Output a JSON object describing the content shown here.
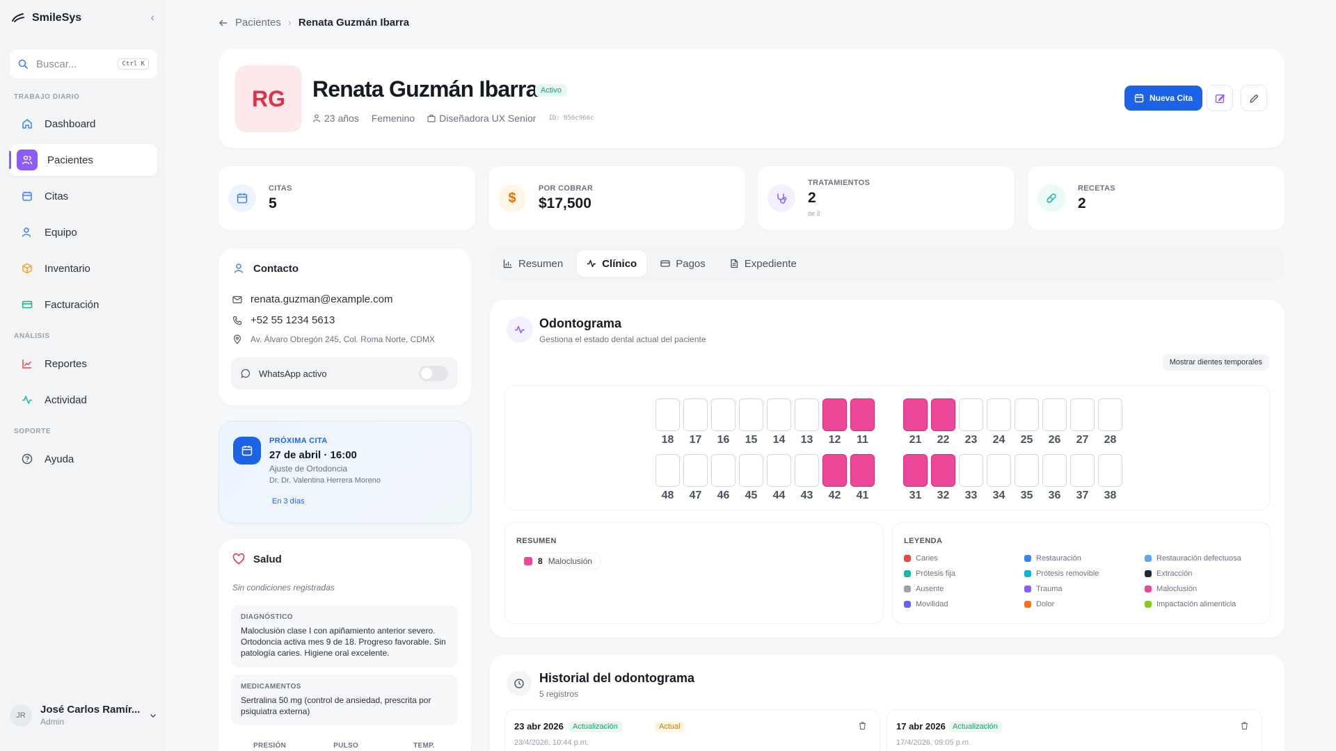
{
  "app": {
    "name": "SmileSys"
  },
  "search": {
    "placeholder": "Buscar...",
    "shortcut": "Ctrl K"
  },
  "sidebar": {
    "sections": [
      "Trabajo diario",
      "Análisis",
      "Soporte"
    ],
    "items": [
      {
        "label": "Dashboard",
        "icon": "home-icon",
        "color": "#3b82f6"
      },
      {
        "label": "Pacientes",
        "icon": "users-icon",
        "color": "#ffffff",
        "active": true
      },
      {
        "label": "Citas",
        "icon": "calendar-icon",
        "color": "#3b82f6"
      },
      {
        "label": "Equipo",
        "icon": "user-icon",
        "color": "#3b82f6"
      },
      {
        "label": "Inventario",
        "icon": "box-icon",
        "color": "#f59e0b"
      },
      {
        "label": "Facturación",
        "icon": "credit-card-icon",
        "color": "#10b981"
      },
      {
        "label": "Reportes",
        "icon": "trend-icon",
        "color": "#ef4444"
      },
      {
        "label": "Actividad",
        "icon": "activity-icon",
        "color": "#14b8a6"
      },
      {
        "label": "Ayuda",
        "icon": "help-icon",
        "color": "#4b5160"
      }
    ]
  },
  "user": {
    "initials": "JR",
    "name": "José Carlos Ramír...",
    "role": "Admin"
  },
  "breadcrumb": {
    "parent": "Pacientes",
    "current": "Renata Guzmán Ibarra"
  },
  "patient": {
    "initials": "RG",
    "name": "Renata Guzmán Ibarra",
    "status": "Activo",
    "age": "23 años",
    "gender": "Femenino",
    "occupation": "Diseñadora UX Senior",
    "id": "ID: 056c966c"
  },
  "actions": {
    "new_appointment": "Nueva Cita"
  },
  "stats": [
    {
      "label": "CITAS",
      "value": "5",
      "sub": "",
      "color": "#3b82f6",
      "bg": "#eef4ff"
    },
    {
      "label": "POR COBRAR",
      "value": "$17,500",
      "sub": "",
      "color": "#d97706",
      "bg": "#fff6e6"
    },
    {
      "label": "TRATAMIENTOS",
      "value": "2",
      "sub": "de 2",
      "color": "#8b5cf6",
      "bg": "#f3efff"
    },
    {
      "label": "RECETAS",
      "value": "2",
      "sub": "",
      "color": "#14b8a6",
      "bg": "#eafaf7"
    }
  ],
  "contact": {
    "title": "Contacto",
    "email": "renata.guzman@example.com",
    "phone": "+52 55 1234 5613",
    "address": "Av. Álvaro Obregón 245, Col. Roma Norte, CDMX",
    "whatsapp": "WhatsApp activo"
  },
  "next_appointment": {
    "label": "PRÓXIMA CITA",
    "date": "27 de abril · 16:00",
    "type": "Ajuste de Ortodoncia",
    "doctor": "Dr. Dr. Valentina Herrera Moreno",
    "in": "En 3 días"
  },
  "health": {
    "title": "Salud",
    "no_conditions": "Sin condiciones registradas",
    "diagnosis_label": "DIAGNÓSTICO",
    "diagnosis": "Maloclusión clase I con apiñamiento anterior severo. Ortodoncia activa mes 9 de 18. Progreso favorable. Sin patología caries. Higiene oral excelente.",
    "meds_label": "MEDICAMENTOS",
    "meds": "Sertralina 50 mg (control de ansiedad, prescrita por psiquiatra externa)",
    "vitals": [
      "PRESIÓN",
      "PULSO",
      "TEMP."
    ]
  },
  "tabs": [
    {
      "label": "Resumen",
      "icon": "bar-chart-icon"
    },
    {
      "label": "Clínico",
      "icon": "activity-icon",
      "active": true
    },
    {
      "label": "Pagos",
      "icon": "credit-card-icon"
    },
    {
      "label": "Expediente",
      "icon": "file-icon"
    }
  ],
  "odontogram": {
    "title": "Odontograma",
    "subtitle": "Gestiona el estado dental actual del paciente",
    "toggle_temporary": "Mostrar dientes temporales",
    "upper_right": [
      18,
      17,
      16,
      15,
      14,
      13,
      12,
      11
    ],
    "upper_left": [
      21,
      22,
      23,
      24,
      25,
      26,
      27,
      28
    ],
    "lower_right": [
      48,
      47,
      46,
      45,
      44,
      43,
      42,
      41
    ],
    "lower_left": [
      31,
      32,
      33,
      34,
      35,
      36,
      37,
      38
    ],
    "malocclusion_teeth": [
      12,
      11,
      21,
      22,
      42,
      41,
      31,
      32
    ],
    "summary_label": "RESUMEN",
    "summary": [
      {
        "count": "8",
        "label": "Maloclusión",
        "color": "#ec4899"
      }
    ],
    "legend_label": "LEYENDA",
    "legend": [
      {
        "label": "Caries",
        "color": "#ef4444"
      },
      {
        "label": "Restauración",
        "color": "#3b82f6"
      },
      {
        "label": "Restauración defectuosa",
        "color": "#60a5fa"
      },
      {
        "label": "Prótesis fija",
        "color": "#14b8a6"
      },
      {
        "label": "Prótesis removible",
        "color": "#06b6d4"
      },
      {
        "label": "Extracción",
        "color": "#1f2937"
      },
      {
        "label": "Ausente",
        "color": "#9ca3af"
      },
      {
        "label": "Trauma",
        "color": "#8b5cf6"
      },
      {
        "label": "Maloclusión",
        "color": "#ec4899"
      },
      {
        "label": "Movilidad",
        "color": "#6366f1"
      },
      {
        "label": "Dolor",
        "color": "#f97316"
      },
      {
        "label": "Impactación alimenticia",
        "color": "#84cc16"
      }
    ]
  },
  "history": {
    "title": "Historial del odontograma",
    "count": "5 registros",
    "entries": [
      {
        "date": "23 abr 2026",
        "tag": "Actualización",
        "current": "Actual",
        "stamp": "23/4/2026, 10:44 p.m."
      },
      {
        "date": "17 abr 2026",
        "tag": "Actualización",
        "stamp": "17/4/2026, 09:05 p.m."
      }
    ]
  }
}
